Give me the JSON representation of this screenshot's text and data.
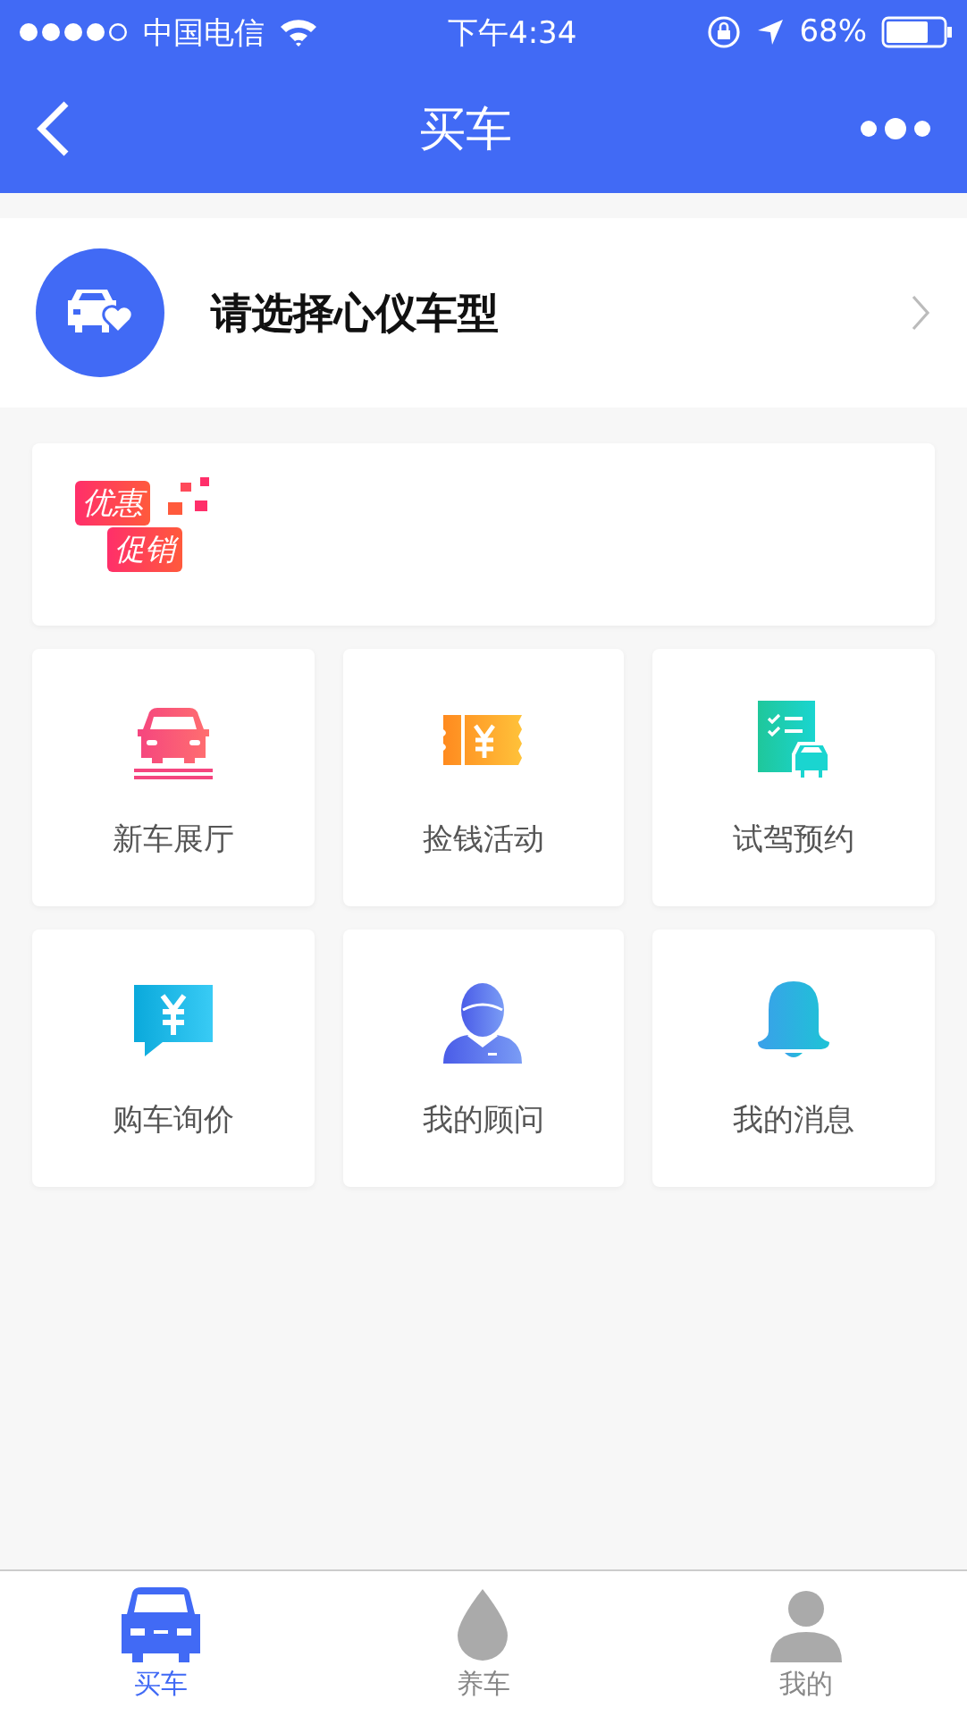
{
  "status_bar": {
    "carrier": "中国电信",
    "time": "下午4:34",
    "battery": "68%"
  },
  "nav": {
    "title": "买车"
  },
  "model_picker": {
    "label": "请选择心仪车型"
  },
  "promo": {
    "lines": [
      "优惠",
      "促销"
    ]
  },
  "tiles": [
    {
      "label": "新车展厅",
      "kind": "car"
    },
    {
      "label": "捡钱活动",
      "kind": "coupon"
    },
    {
      "label": "试驾预约",
      "kind": "testdrive"
    },
    {
      "label": "购车询价",
      "kind": "price"
    },
    {
      "label": "我的顾问",
      "kind": "advisor"
    },
    {
      "label": "我的消息",
      "kind": "bell"
    }
  ],
  "tabs": [
    {
      "label": "买车",
      "kind": "car",
      "selected": true
    },
    {
      "label": "养车",
      "kind": "care",
      "selected": false
    },
    {
      "label": "我的",
      "kind": "me",
      "selected": false
    }
  ]
}
